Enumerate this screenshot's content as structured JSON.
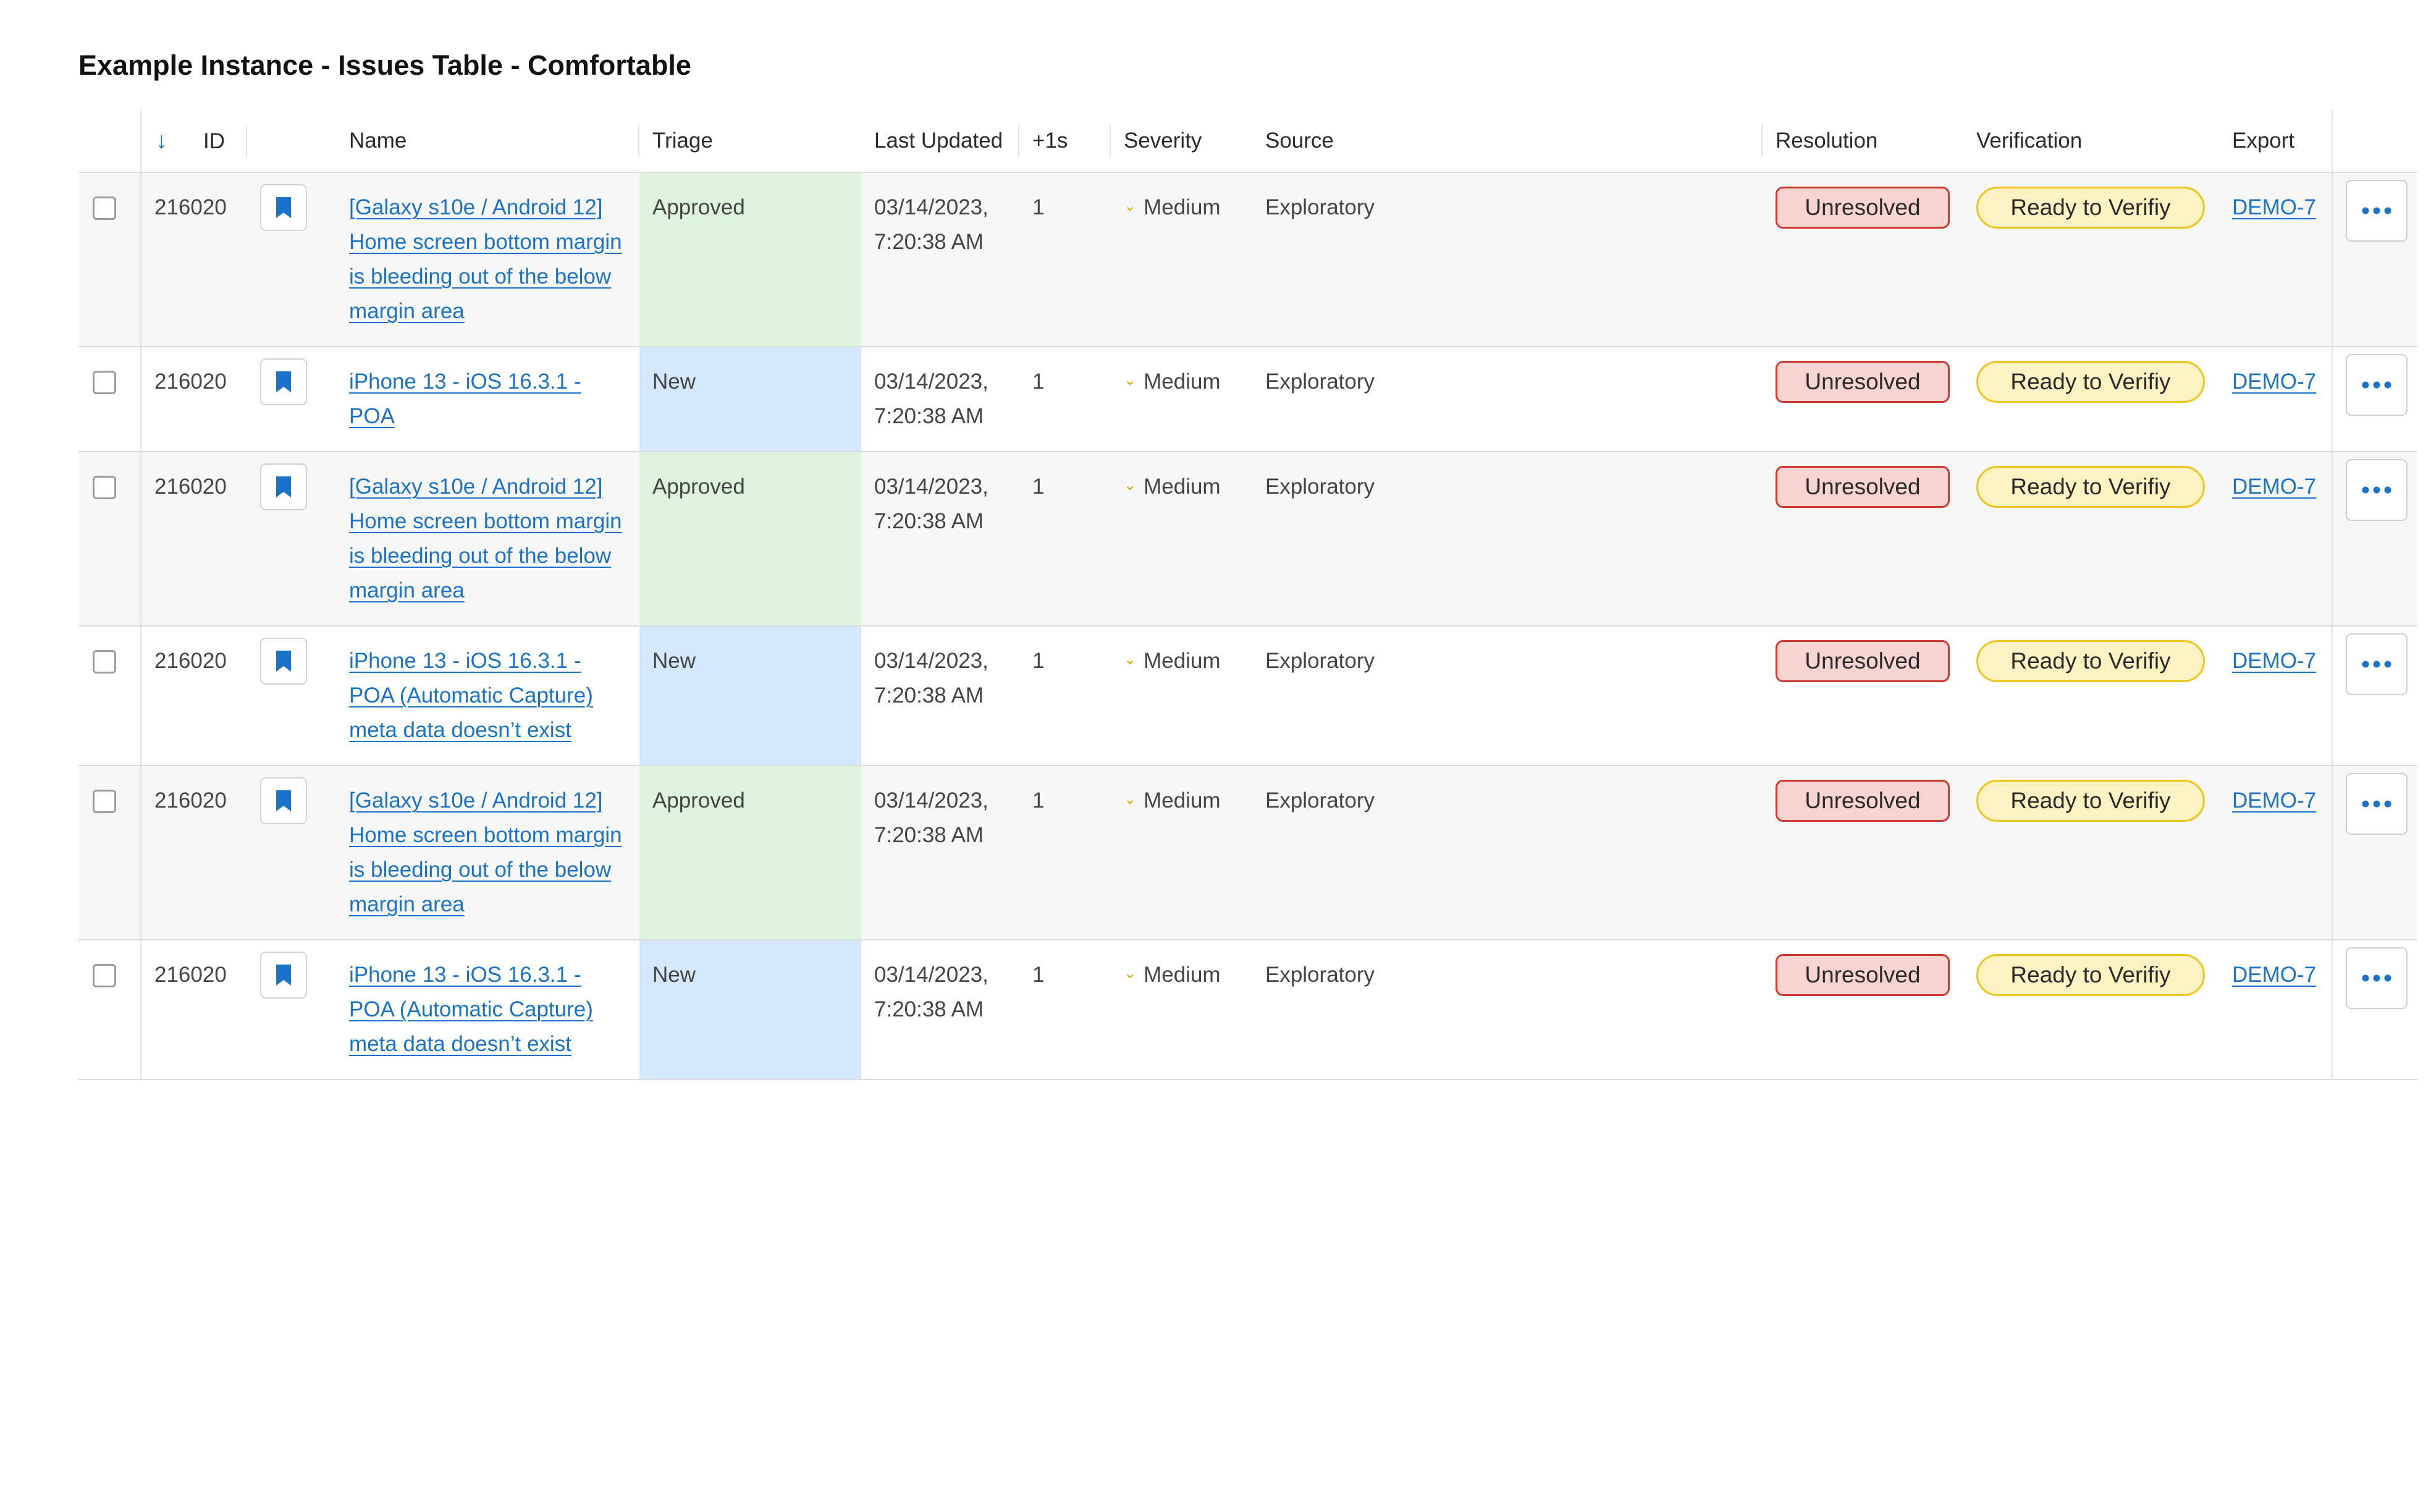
{
  "page": {
    "title": "Example Instance - Issues Table - Comfortable"
  },
  "colors": {
    "link": "#1a73c8",
    "triage_approved_bg": "#ddf3dd",
    "triage_new_bg": "#d3e8fb",
    "unresolved_bg": "#f7d4d0",
    "unresolved_border": "#cf3a30",
    "verify_bg": "#fdf2c2",
    "verify_border": "#f0c419",
    "severity_chevron": "#e0a500"
  },
  "table": {
    "sort_icon": "arrow-down-icon",
    "columns": {
      "id": "ID",
      "name": "Name",
      "triage": "Triage",
      "last_updated": "Last Updated",
      "plus_ones": "+1s",
      "severity": "Severity",
      "source": "Source",
      "resolution": "Resolution",
      "verification": "Verification",
      "export": "Export"
    },
    "rows": [
      {
        "id": "216020",
        "name": "[Galaxy s10e / Android 12] Home screen bottom margin is bleeding out of the below margin area",
        "triage": "Approved",
        "date": "03/14/2023,",
        "time": "7:20:38 AM",
        "plus_ones": "1",
        "severity": "Medium",
        "source": "Exploratory",
        "resolution": "Unresolved",
        "verification": "Ready to Verifiy",
        "export": "DEMO-7"
      },
      {
        "id": "216020",
        "name": "iPhone 13 - iOS 16.3.1 - POA",
        "triage": "New",
        "date": "03/14/2023,",
        "time": "7:20:38 AM",
        "plus_ones": "1",
        "severity": "Medium",
        "source": "Exploratory",
        "resolution": "Unresolved",
        "verification": "Ready to Verifiy",
        "export": "DEMO-7"
      },
      {
        "id": "216020",
        "name": "[Galaxy s10e / Android 12] Home screen bottom margin is bleeding out of the below margin area",
        "triage": "Approved",
        "date": "03/14/2023,",
        "time": "7:20:38 AM",
        "plus_ones": "1",
        "severity": "Medium",
        "source": "Exploratory",
        "resolution": "Unresolved",
        "verification": "Ready to Verifiy",
        "export": "DEMO-7"
      },
      {
        "id": "216020",
        "name": "iPhone 13 - iOS 16.3.1 - POA (Automatic Capture) meta data doesn’t exist",
        "triage": "New",
        "date": "03/14/2023,",
        "time": "7:20:38 AM",
        "plus_ones": "1",
        "severity": "Medium",
        "source": "Exploratory",
        "resolution": "Unresolved",
        "verification": "Ready to Verifiy",
        "export": "DEMO-7"
      },
      {
        "id": "216020",
        "name": "[Galaxy s10e / Android 12] Home screen bottom margin is bleeding out of the below margin area",
        "triage": "Approved",
        "date": "03/14/2023,",
        "time": "7:20:38 AM",
        "plus_ones": "1",
        "severity": "Medium",
        "source": "Exploratory",
        "resolution": "Unresolved",
        "verification": "Ready to Verifiy",
        "export": "DEMO-7"
      },
      {
        "id": "216020",
        "name": "iPhone 13 - iOS 16.3.1 - POA (Automatic Capture) meta data doesn’t exist",
        "triage": "New",
        "date": "03/14/2023,",
        "time": "7:20:38 AM",
        "plus_ones": "1",
        "severity": "Medium",
        "source": "Exploratory",
        "resolution": "Unresolved",
        "verification": "Ready to Verifiy",
        "export": "DEMO-7"
      }
    ]
  }
}
